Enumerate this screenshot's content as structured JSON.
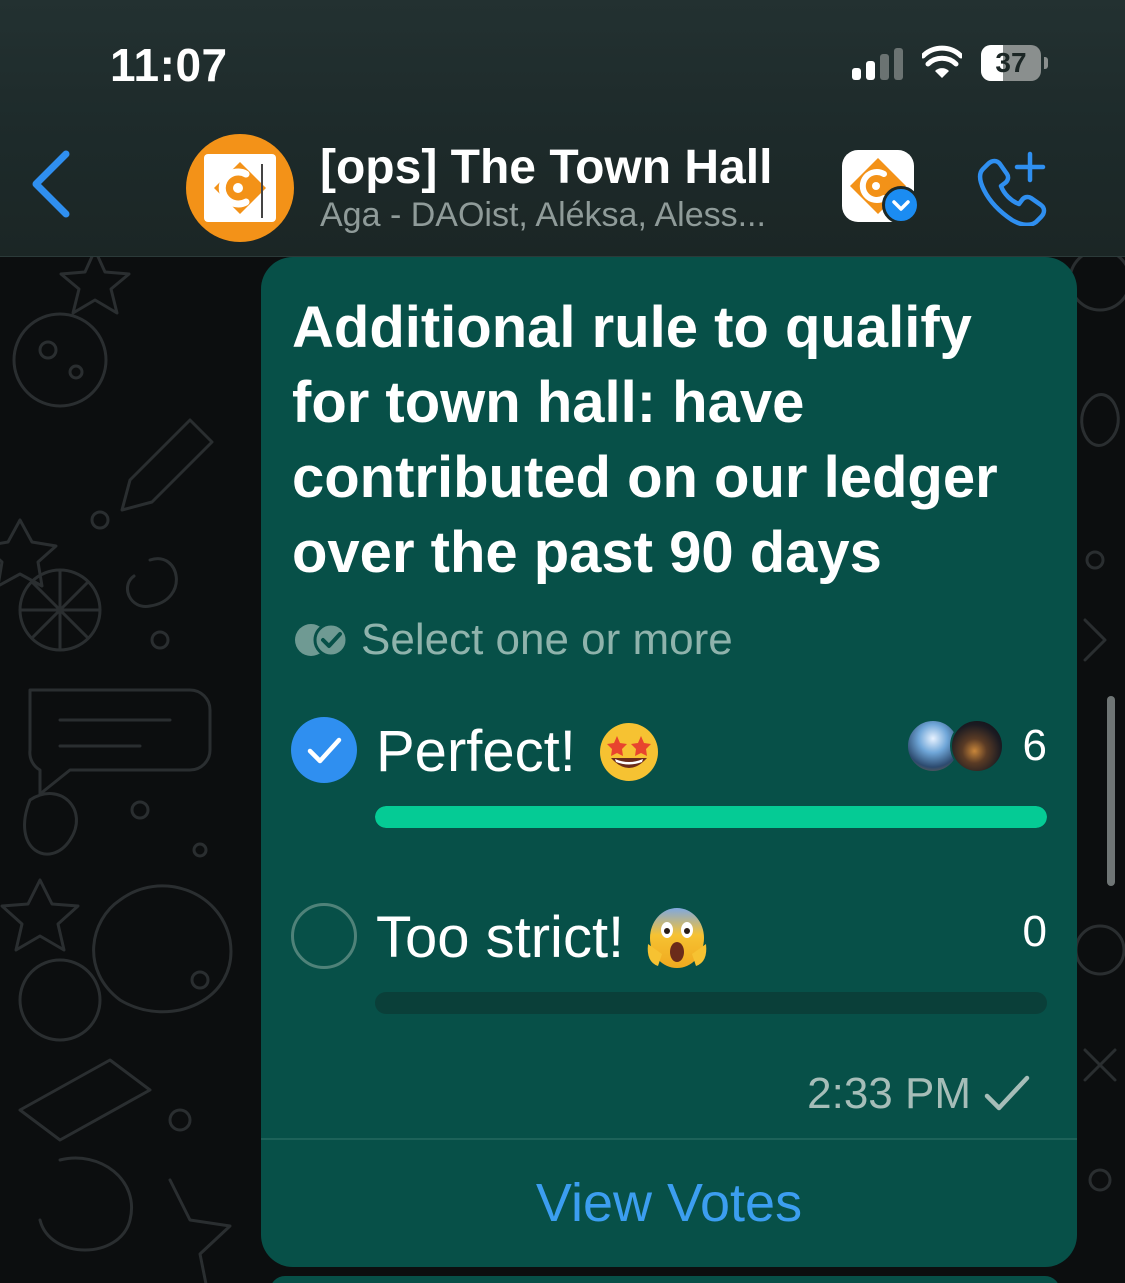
{
  "status_bar": {
    "time": "11:07",
    "battery_level": "37",
    "battery_fraction": 0.37,
    "signal_bars_active": 2,
    "signal_bars_total": 4
  },
  "header": {
    "back_icon": "chevron-left-icon",
    "group_title": "[ops] The Town Hall",
    "group_subtitle": "Aga - DAOist, Aléksa, Aless...",
    "community_icon": "community-badge-icon",
    "call_icon": "phone-add-icon"
  },
  "poll": {
    "question": "Additional rule to qualify for town hall: have contributed on our ledger over the past 90 days",
    "select_hint": "Select one or more",
    "options": [
      {
        "label": "Perfect!",
        "emoji": "star-struck-emoji",
        "count": "6",
        "selected": true,
        "fraction": 1.0
      },
      {
        "label": "Too strict!",
        "emoji": "screaming-face-emoji",
        "count": "0",
        "selected": false,
        "fraction": 0.0
      }
    ],
    "time": "2:33 PM",
    "status_icon": "sent-check-icon",
    "view_votes_label": "View Votes"
  },
  "colors": {
    "bubble": "#075048",
    "accent_blue": "#1b8cf2",
    "bar_fill": "#05cb95",
    "group_avatar": "#f39218"
  }
}
